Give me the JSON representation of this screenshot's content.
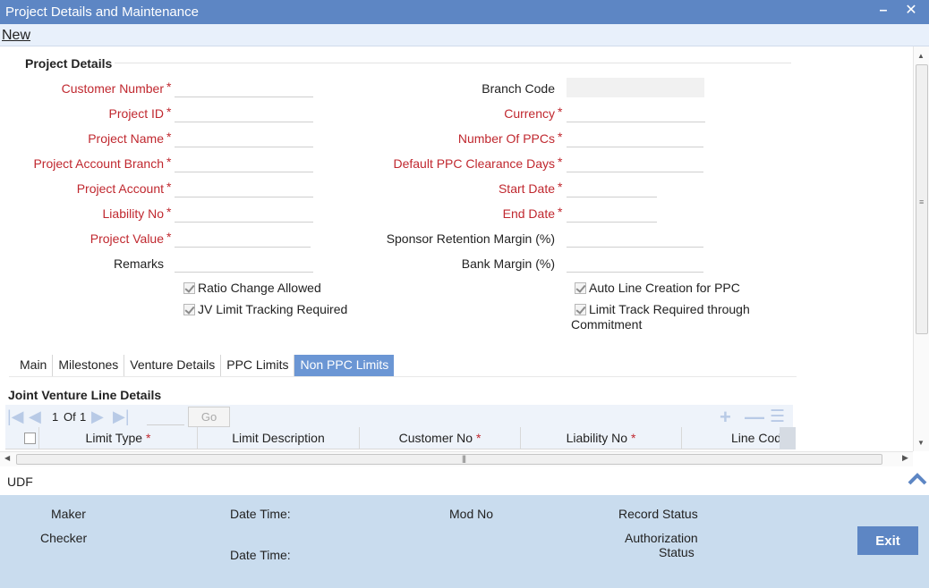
{
  "window": {
    "title": "Project Details and Maintenance",
    "minimize_glyph": "–",
    "close_glyph": "✕"
  },
  "toolbar": {
    "new_label": "New"
  },
  "section": {
    "title": "Project Details"
  },
  "form_left": [
    {
      "label": "Customer Number",
      "required": true,
      "value": ""
    },
    {
      "label": "Project ID",
      "required": true,
      "value": ""
    },
    {
      "label": "Project Name",
      "required": true,
      "value": ""
    },
    {
      "label": "Project Account Branch",
      "required": true,
      "value": ""
    },
    {
      "label": "Project Account",
      "required": true,
      "value": ""
    },
    {
      "label": "Liability No",
      "required": true,
      "value": ""
    },
    {
      "label": "Project Value",
      "required": true,
      "value": ""
    },
    {
      "label": "Remarks",
      "required": false,
      "value": ""
    }
  ],
  "form_right": [
    {
      "label": "Branch Code",
      "required": false,
      "value": ""
    },
    {
      "label": "Currency",
      "required": true,
      "value": ""
    },
    {
      "label": "Number Of PPCs",
      "required": true,
      "value": ""
    },
    {
      "label": "Default PPC Clearance Days",
      "required": true,
      "value": ""
    },
    {
      "label": "Start Date",
      "required": true,
      "value": ""
    },
    {
      "label": "End Date",
      "required": true,
      "value": ""
    },
    {
      "label": "Sponsor Retention Margin (%)",
      "required": false,
      "value": ""
    },
    {
      "label": "Bank Margin (%)",
      "required": false,
      "value": ""
    }
  ],
  "required_marker": "*",
  "checkboxes": {
    "ratio_change": {
      "label": "Ratio Change Allowed",
      "checked": true
    },
    "jv_limit": {
      "label": "JV Limit Tracking Required",
      "checked": true
    },
    "auto_line": {
      "label": "Auto Line Creation for PPC",
      "checked": true
    },
    "limit_track_line1": "Limit Track Required through",
    "limit_track_line2": "Commitment",
    "limit_track_checked": true
  },
  "tabs": [
    {
      "label": "Main",
      "active": false
    },
    {
      "label": "Milestones",
      "active": false
    },
    {
      "label": "Venture Details",
      "active": false
    },
    {
      "label": "PPC Limits",
      "active": false
    },
    {
      "label": "Non PPC Limits",
      "active": true
    }
  ],
  "grid": {
    "title": "Joint Venture Line Details",
    "page_current": "1",
    "page_of": "Of",
    "page_total": "1",
    "go_label": "Go",
    "columns": [
      "Limit Type",
      "Limit Description",
      "Customer No",
      "Liability No",
      "Line Code"
    ],
    "required_columns": [
      true,
      false,
      true,
      true,
      false
    ]
  },
  "udf": {
    "label": "UDF"
  },
  "audit": {
    "maker": "Maker",
    "checker": "Checker",
    "date_time": "Date Time:",
    "mod_no": "Mod No",
    "record_status": "Record Status",
    "authorization_1": "Authorization",
    "authorization_2": "Status",
    "exit_label": "Exit"
  },
  "colors": {
    "title_bar": "#5d86c4",
    "required_label": "#c0282f",
    "active_tab": "#6b96d4",
    "audit_bg": "#c9dcee"
  }
}
